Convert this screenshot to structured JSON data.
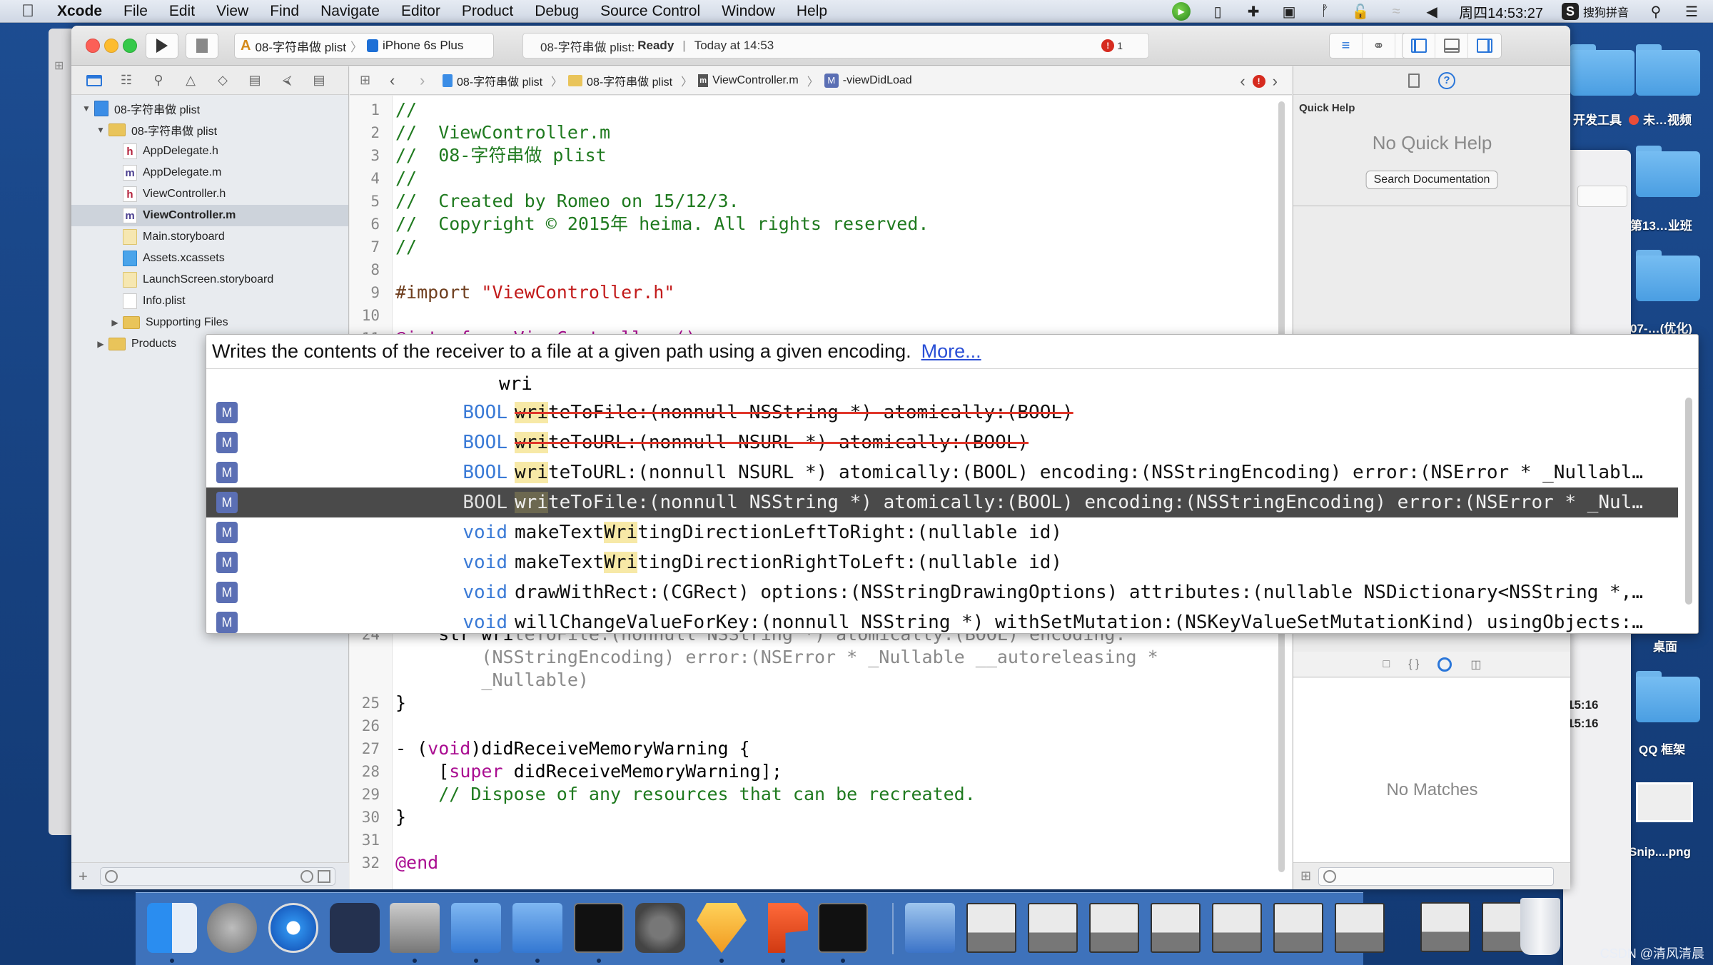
{
  "menubar": {
    "apple": "",
    "items": [
      "Xcode",
      "File",
      "Edit",
      "View",
      "Find",
      "Navigate",
      "Editor",
      "Product",
      "Debug",
      "Source Control",
      "Window",
      "Help"
    ],
    "clock": "周四14:53:27",
    "input_method": "搜狗拼音",
    "tray_icons": [
      "screen-recorder-icon",
      "power-icon",
      "plane-icon",
      "camera-icon",
      "bluetooth-icon",
      "lock-icon",
      "wifi-icon",
      "volume-icon"
    ]
  },
  "desktop": {
    "items": [
      {
        "label": "开发工具"
      },
      {
        "label": "未…视频",
        "tag_color": "#ea4d39"
      },
      {
        "label": "第13…业班"
      },
      {
        "label": "07-…(优化)"
      },
      {
        "label": "桌面"
      },
      {
        "label": "QQ 框架"
      },
      {
        "label": "Snip....png"
      }
    ],
    "background_window_times": [
      "15:16",
      "15:16"
    ]
  },
  "xcode": {
    "scheme": "08-字符串做 plist",
    "device": "iPhone 6s Plus",
    "activity": {
      "project": "08-字符串做 plist:",
      "status": "Ready",
      "time": "Today at 14:53",
      "error_count": "1"
    },
    "jumpbar": {
      "crumbs": [
        "08-字符串做 plist",
        "08-字符串做 plist",
        "ViewController.m",
        "-viewDidLoad"
      ],
      "issue_badge": "!"
    },
    "navigator": {
      "tabs": [
        "project-navigator",
        "symbol-navigator",
        "find-navigator",
        "issue-navigator",
        "test-navigator",
        "debug-navigator",
        "breakpoint-navigator",
        "report-navigator"
      ],
      "tree": [
        {
          "label": "08-字符串做 plist",
          "kind": "proj",
          "level": 0,
          "disclosure": "▼"
        },
        {
          "label": "08-字符串做 plist",
          "kind": "folder",
          "level": 1,
          "disclosure": "▼"
        },
        {
          "label": "AppDelegate.h",
          "kind": "h",
          "level": 2
        },
        {
          "label": "AppDelegate.m",
          "kind": "m",
          "level": 2
        },
        {
          "label": "ViewController.h",
          "kind": "h",
          "level": 2
        },
        {
          "label": "ViewController.m",
          "kind": "m",
          "level": 2,
          "selected": true
        },
        {
          "label": "Main.storyboard",
          "kind": "sb",
          "level": 2
        },
        {
          "label": "Assets.xcassets",
          "kind": "assets",
          "level": 2
        },
        {
          "label": "LaunchScreen.storyboard",
          "kind": "sb",
          "level": 2
        },
        {
          "label": "Info.plist",
          "kind": "plist",
          "level": 2
        },
        {
          "label": "Supporting Files",
          "kind": "folder",
          "level": 2,
          "disclosure": "▶"
        },
        {
          "label": "Products",
          "kind": "folder",
          "level": 1,
          "disclosure": "▶"
        }
      ]
    },
    "editor": {
      "lines_top": [
        {
          "n": "1",
          "text": "//",
          "cls": "c-comment"
        },
        {
          "n": "2",
          "text": "//  ViewController.m",
          "cls": "c-comment"
        },
        {
          "n": "3",
          "text": "//  08-字符串做 plist",
          "cls": "c-comment"
        },
        {
          "n": "4",
          "text": "//",
          "cls": "c-comment"
        },
        {
          "n": "5",
          "text": "//  Created by Romeo on 15/12/3.",
          "cls": "c-comment"
        },
        {
          "n": "6",
          "text": "//  Copyright © 2015年 heima. All rights reserved.",
          "cls": "c-comment"
        },
        {
          "n": "7",
          "text": "//",
          "cls": "c-comment"
        },
        {
          "n": "8",
          "text": "",
          "cls": ""
        },
        {
          "n": "9",
          "text_pre": "#import ",
          "text_str": "\"ViewController.h\""
        },
        {
          "n": "10",
          "text": "",
          "cls": ""
        },
        {
          "n": "11",
          "text": "@interface ViewController ()",
          "cls": "c-kw"
        }
      ],
      "line24": {
        "n": "24",
        "typed": "    str wri",
        "ghost": "teToFile:(nonnull NSString *) atomically:(BOOL) encoding:",
        "ghost2": "        (NSStringEncoding) error:(NSError * _Nullable __autoreleasing *",
        "ghost3": "        _Nullable)"
      },
      "lines_bottom": [
        {
          "n": "25",
          "text": "}"
        },
        {
          "n": "26",
          "text": ""
        },
        {
          "n": "27",
          "pre": "- (",
          "kw": "void",
          "post": ")didReceiveMemoryWarning {"
        },
        {
          "n": "28",
          "pre": "    [",
          "kw": "super",
          "post": " didReceiveMemoryWarning];"
        },
        {
          "n": "29",
          "comment": "    // Dispose of any resources that can be recreated."
        },
        {
          "n": "30",
          "text": "}"
        },
        {
          "n": "31",
          "text": ""
        },
        {
          "n": "32",
          "kwonly": "@end"
        }
      ]
    },
    "completion": {
      "doc": "Writes the contents of the receiver to a file at a given path using a given encoding.",
      "more": "More...",
      "typed": "wri",
      "selected_index": 3,
      "items": [
        {
          "badge": "M",
          "type": "BOOL",
          "hl": "wri",
          "rest": "teToFile:(nonnull NSString *) atomically:(BOOL)",
          "deprecated": true
        },
        {
          "badge": "M",
          "type": "BOOL",
          "hl": "wri",
          "rest": "teToURL:(nonnull NSURL *) atomically:(BOOL)",
          "deprecated": true
        },
        {
          "badge": "M",
          "type": "BOOL",
          "hl": "wri",
          "rest": "teToURL:(nonnull NSURL *) atomically:(BOOL) encoding:(NSStringEncoding) error:(NSError * _Nullabl…",
          "deprecated": false
        },
        {
          "badge": "M",
          "type": "BOOL",
          "hl": "wri",
          "rest": "teToFile:(nonnull NSString *) atomically:(BOOL) encoding:(NSStringEncoding) error:(NSError * _Nul…",
          "deprecated": false
        },
        {
          "badge": "M",
          "type": "void",
          "pre": "makeText",
          "hl": "Wri",
          "rest": "tingDirectionLeftToRight:(nullable id)",
          "deprecated": false
        },
        {
          "badge": "M",
          "type": "void",
          "pre": "makeText",
          "hl": "Wri",
          "rest": "tingDirectionRightToLeft:(nullable id)",
          "deprecated": false
        },
        {
          "badge": "M",
          "type": "void",
          "pre": "",
          "hl": "",
          "rest": "drawWithRect:(CGRect) options:(NSStringDrawingOptions) attributes:(nullable NSDictionary<NSString *,…",
          "deprecated": false
        },
        {
          "badge": "M",
          "type": "void",
          "pre": "",
          "hl": "",
          "rest": "willChangeValueForKey:(nonnull NSString *) withSetMutation:(NSKeyValueSetMutationKind) usingObjects:…",
          "deprecated": false
        }
      ]
    },
    "utilities": {
      "quick_help_title": "Quick Help",
      "quick_help_empty": "No Quick Help",
      "search_button": "Search Documentation",
      "library_empty": "No Matches"
    }
  },
  "dock": {
    "apps": [
      "Finder",
      "Launchpad",
      "Safari",
      "Mouse",
      "Video",
      "Xcode",
      "Simulator",
      "Terminal",
      "System Preferences",
      "Sketch",
      "P App",
      "Exec"
    ],
    "windows": [
      "QQ Player",
      "Window 1",
      "Window 2",
      "Window 3",
      "Window 4",
      "Window 5",
      "Window 6",
      "Window 7",
      "Window 8",
      "Window 9"
    ],
    "trash": "Trash"
  },
  "watermark": "CSDN @清风清晨"
}
